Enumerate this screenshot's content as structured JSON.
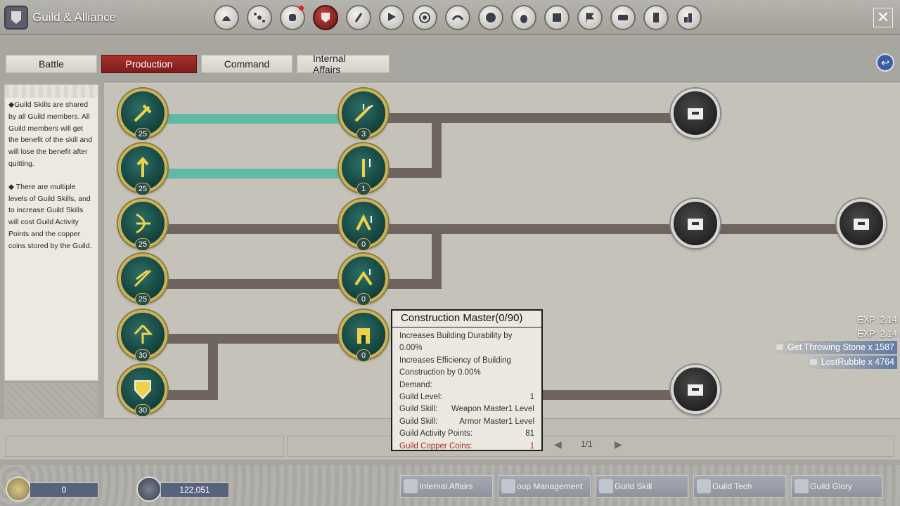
{
  "window": {
    "title": "Guild & Alliance",
    "close_label": "✕"
  },
  "top_icons": [
    {
      "icon": "helmet-icon",
      "active": false,
      "dot": false
    },
    {
      "icon": "network-icon",
      "active": false,
      "dot": false
    },
    {
      "icon": "hand-icon",
      "active": false,
      "dot": true
    },
    {
      "icon": "guild-emblem-icon",
      "active": true,
      "dot": false
    },
    {
      "icon": "brush-icon",
      "active": false,
      "dot": false
    },
    {
      "icon": "banner-icon",
      "active": false,
      "dot": false
    },
    {
      "icon": "target-icon",
      "active": false,
      "dot": false
    },
    {
      "icon": "dragon-icon",
      "active": false,
      "dot": false
    },
    {
      "icon": "face-icon",
      "active": false,
      "dot": false
    },
    {
      "icon": "gourd-icon",
      "active": false,
      "dot": false
    },
    {
      "icon": "book-icon",
      "active": false,
      "dot": false
    },
    {
      "icon": "flag-icon",
      "active": false,
      "dot": false
    },
    {
      "icon": "scroll-icon",
      "active": false,
      "dot": false
    },
    {
      "icon": "tablet-icon",
      "active": false,
      "dot": false
    },
    {
      "icon": "buildings-icon",
      "active": false,
      "dot": false
    }
  ],
  "tabs": [
    {
      "label": "Battle",
      "active": false
    },
    {
      "label": "Production",
      "active": true
    },
    {
      "label": "Command",
      "active": false
    },
    {
      "label": "Internal Affairs",
      "active": false
    }
  ],
  "info": {
    "p1": "◆Guild Skills are shared by all Guild members. All Guild members will get the benefit of the skill and will lose the benefit after quitting.",
    "p2": "◆ There are multiple levels of Guild Skills, and to increase Guild Skills will cost Guild Activity Points and the copper coins stored by the Guild."
  },
  "skills": {
    "col1": [
      "25",
      "25",
      "25",
      "25",
      "30",
      "30"
    ],
    "col2": [
      "3",
      "1",
      "0",
      "0",
      "0"
    ]
  },
  "tooltip": {
    "title": "Construction Master(0/90)",
    "line1": "Increases Building Durability by",
    "line2": "0.00%",
    "line3": "Increases Efficiency of Building",
    "line4": "Construction by 0.00%",
    "demand": "Demand:",
    "rows": [
      {
        "label": "Guild Level:",
        "value": "1"
      },
      {
        "label": "Guild Skill:",
        "value": "Weapon Master1 Level"
      },
      {
        "label": "Guild Skill:",
        "value": "Armor Master1 Level"
      },
      {
        "label": "Guild Activity Points:",
        "value": "81"
      }
    ],
    "copper": {
      "label": "Guild Copper Coins:",
      "value": "1"
    }
  },
  "exp": [
    "EXP: 2.14",
    "EXP: 2.14"
  ],
  "rewards": [
    "Get Throwing Stone x 1587",
    "LostRubble x 4764"
  ],
  "pagination": {
    "text": "1/1",
    "prev": "◀",
    "next": "▶"
  },
  "resources": {
    "copper": "0",
    "silver": "122,051"
  },
  "bottom_nav": [
    {
      "label": "Internal Affairs",
      "icon": "ledger-icon"
    },
    {
      "label": "oup Management",
      "icon": "group-icon"
    },
    {
      "label": "Guild Skill",
      "icon": "skill-icon"
    },
    {
      "label": "Guild Tech",
      "icon": "tech-icon"
    },
    {
      "label": "Guild Glory",
      "icon": "glory-icon"
    }
  ],
  "colors": {
    "accent_red": "#9a2723",
    "teal": "#5fb9a3",
    "path": "#6f6560",
    "gold": "#c8b25a"
  }
}
